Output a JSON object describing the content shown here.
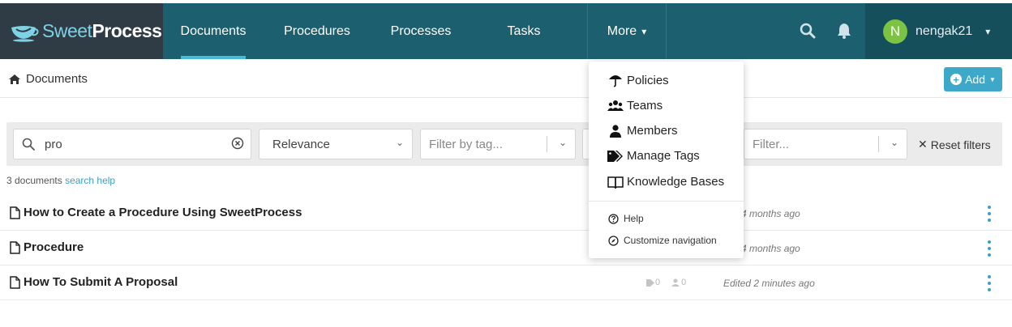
{
  "brand": {
    "part1": "Sweet",
    "part2": "Process"
  },
  "nav": {
    "items": [
      {
        "label": "Documents",
        "active": true
      },
      {
        "label": "Procedures",
        "active": false
      },
      {
        "label": "Processes",
        "active": false
      },
      {
        "label": "Tasks",
        "active": false
      }
    ],
    "more_label": "More"
  },
  "user": {
    "initial": "N",
    "name": "nengak21",
    "avatar_color": "#7cc243"
  },
  "breadcrumb": {
    "label": "Documents"
  },
  "add_button": {
    "label": "Add"
  },
  "filters": {
    "search_value": "pro",
    "sort_value": "Relevance",
    "tag_placeholder": "Filter by tag...",
    "filter_placeholder": "Filter...",
    "reset_label": "Reset filters"
  },
  "results": {
    "count_text": "3 documents",
    "help_link": "search help"
  },
  "documents": [
    {
      "title": "How to Create a Procedure Using SweetProcess",
      "tags": "",
      "members": "",
      "edited": "d 4 months ago"
    },
    {
      "title": "Procedure",
      "tags": "",
      "members": "",
      "edited": "d 4 months ago"
    },
    {
      "title": "How To Submit A Proposal",
      "tags": "0",
      "members": "0",
      "edited": "Edited 2 minutes ago"
    }
  ],
  "more_menu": {
    "items": [
      {
        "label": "Policies",
        "icon": "umbrella-icon"
      },
      {
        "label": "Teams",
        "icon": "users-icon"
      },
      {
        "label": "Members",
        "icon": "user-icon"
      },
      {
        "label": "Manage Tags",
        "icon": "tags-icon"
      },
      {
        "label": "Knowledge Bases",
        "icon": "book-icon"
      }
    ],
    "secondary": [
      {
        "label": "Help",
        "icon": "question-circle-icon"
      },
      {
        "label": "Customize navigation",
        "icon": "compass-icon"
      }
    ]
  },
  "colors": {
    "nav_bg": "#1c5f6f",
    "brand_bg": "#2f3b45",
    "accent": "#3da8c8",
    "active_underline": "#48b9d4"
  }
}
